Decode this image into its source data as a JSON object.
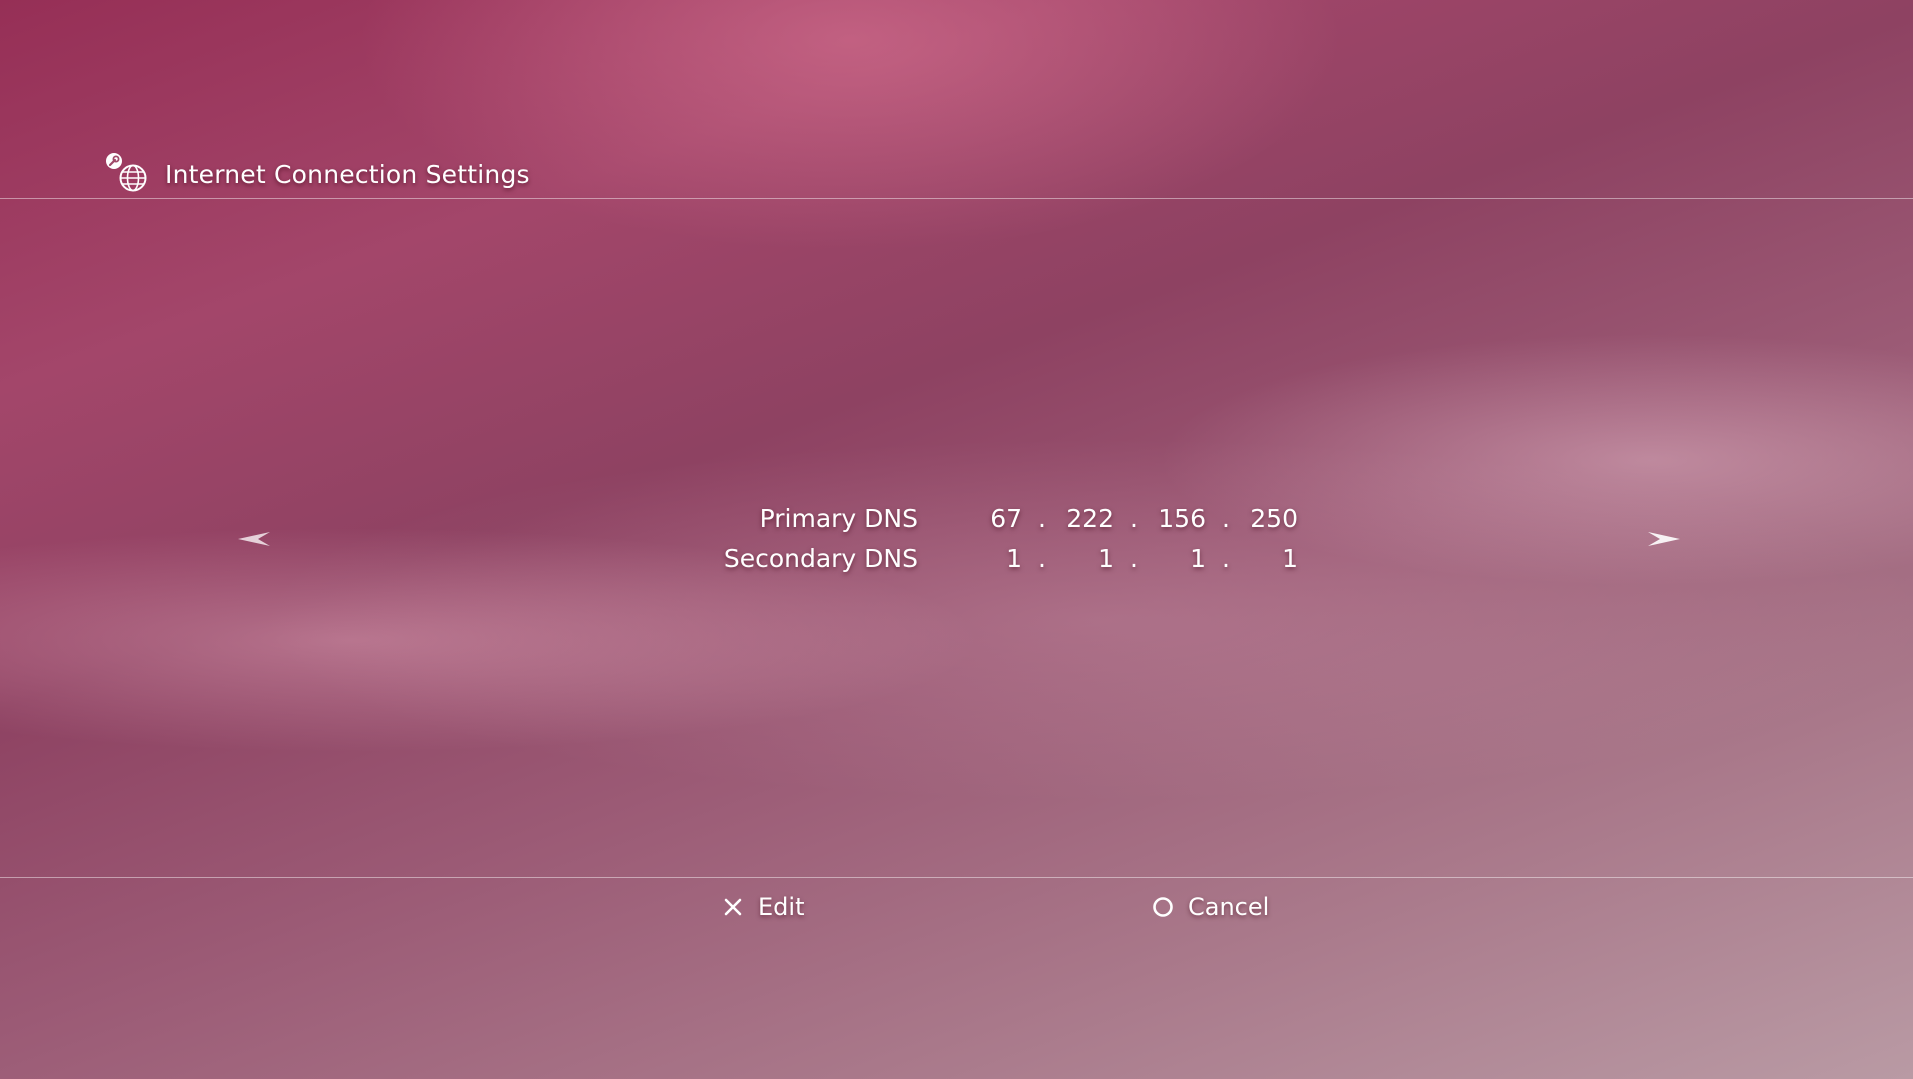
{
  "header": {
    "title": "Internet Connection Settings",
    "icon": "settings-network-icon"
  },
  "dns": {
    "primary": {
      "label": "Primary DNS",
      "octets": [
        "67",
        "222",
        "156",
        "250"
      ]
    },
    "secondary": {
      "label": "Secondary DNS",
      "octets": [
        "1",
        "1",
        "1",
        "1"
      ]
    },
    "separator": "."
  },
  "navigation": {
    "left_icon": "arrow-left-icon",
    "right_icon": "arrow-right-icon"
  },
  "footer": {
    "edit_label": "Edit",
    "cancel_label": "Cancel"
  },
  "colors": {
    "background_primary": "#962f56",
    "background_secondary": "#b99aa4",
    "text": "#ffffff"
  }
}
